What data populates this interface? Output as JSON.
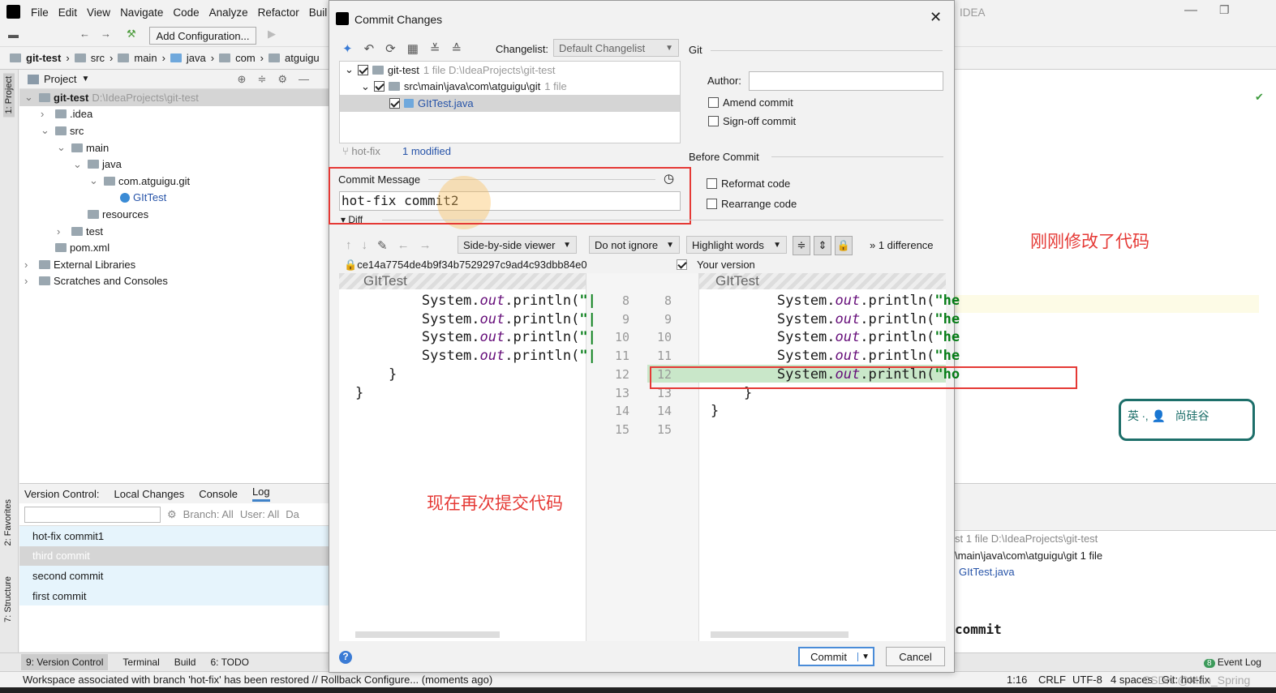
{
  "menu": [
    "File",
    "Edit",
    "View",
    "Navigate",
    "Code",
    "Analyze",
    "Refactor",
    "Buil"
  ],
  "ide_title_fragment": "IDEA",
  "toolbar": {
    "run_config": "Add Configuration..."
  },
  "breadcrumbs": [
    "git-test",
    "src",
    "main",
    "java",
    "com",
    "atguigu"
  ],
  "left_stripe": {
    "project": "1: Project",
    "favorites": "2: Favorites",
    "structure": "7: Structure"
  },
  "project": {
    "header": "Project",
    "tree": [
      {
        "label": "git-test",
        "extra": "D:\\IdeaProjects\\git-test",
        "depth": 0
      },
      {
        "label": ".idea",
        "depth": 1
      },
      {
        "label": "src",
        "depth": 1
      },
      {
        "label": "main",
        "depth": 2
      },
      {
        "label": "java",
        "depth": 3
      },
      {
        "label": "com.atguigu.git",
        "depth": 4
      },
      {
        "label": "GItTest",
        "depth": 5
      },
      {
        "label": "resources",
        "depth": 3
      },
      {
        "label": "test",
        "depth": 2
      },
      {
        "label": "pom.xml",
        "depth": 1
      },
      {
        "label": "External Libraries",
        "depth": 0
      },
      {
        "label": "Scratches and Consoles",
        "depth": 0
      }
    ]
  },
  "vc": {
    "tabs": [
      "Version Control:",
      "Local Changes",
      "Console",
      "Log"
    ],
    "branch": "Branch: All",
    "user": "User: All",
    "date": "Da",
    "commits": [
      "hot-fix commit1",
      "third commit",
      "second commit",
      "first commit"
    ]
  },
  "bottom_stripe": [
    "9: Version Control",
    "Terminal",
    "Build",
    "6: TODO",
    "Event Log"
  ],
  "event_count": "8",
  "status": {
    "message": "Workspace associated with branch 'hot-fix' has been restored // Rollback   Configure... (moments ago)",
    "pos": "1:16",
    "eol": "CRLF",
    "enc": "UTF-8",
    "indent": "4 spaces",
    "git": "Git: hot-fix",
    "watermark": "CSDN @Man_Spring"
  },
  "right": {
    "tree": [
      "st  1 file  D:\\IdeaProjects\\git-test",
      "\\main\\java\\com\\atguigu\\git  1 file",
      "GItTest.java"
    ],
    "commit": "commit",
    "annotation": "刚刚修改了代码"
  },
  "dialog": {
    "title": "Commit Changes",
    "changelist_label": "Changelist:",
    "changelist": "Default Changelist",
    "files": [
      {
        "name": "git-test",
        "meta": "1 file  D:\\IdeaProjects\\git-test"
      },
      {
        "name": "src\\main\\java\\com\\atguigu\\git",
        "meta": "1 file"
      },
      {
        "name": "GItTest.java",
        "meta": ""
      }
    ],
    "branch": "hot-fix",
    "modified": "1 modified",
    "git_section": "Git",
    "author_label": "Author:",
    "author": "",
    "amend": "Amend commit",
    "signoff": "Sign-off commit",
    "before_commit": "Before Commit",
    "reformat": "Reformat code",
    "rearrange": "Rearrange code",
    "msg_label": "Commit Message",
    "message": "hot-fix commit2",
    "diff_label": "Diff",
    "viewer": "Side-by-side viewer",
    "ignore": "Do not ignore",
    "highlight": "Highlight words",
    "differences": "1 difference",
    "hash": "ce14a7754de4b9f34b7529297c9ad4c93dbb84e0",
    "your_version": "Your version",
    "file_left": "GItTest",
    "file_right": "GItTest",
    "left_code": [
      "        System.out.println(\"|",
      "        System.out.println(\"|",
      "        System.out.println(\"|",
      "        System.out.println(\"|",
      "    }",
      "}"
    ],
    "right_code": [
      "        System.out.println(\"he",
      "        System.out.println(\"he",
      "        System.out.println(\"he",
      "        System.out.println(\"he",
      "        System.out.println(\"ho",
      "    }",
      "}"
    ],
    "left_lines": [
      "8",
      "9",
      "10",
      "11",
      "12",
      "13",
      "14",
      "15"
    ],
    "right_lines": [
      "8",
      "9",
      "10",
      "11",
      "12",
      "13",
      "14",
      "15"
    ],
    "commit_btn": "Commit",
    "cancel_btn": "Cancel",
    "annotation": "现在再次提交代码"
  }
}
